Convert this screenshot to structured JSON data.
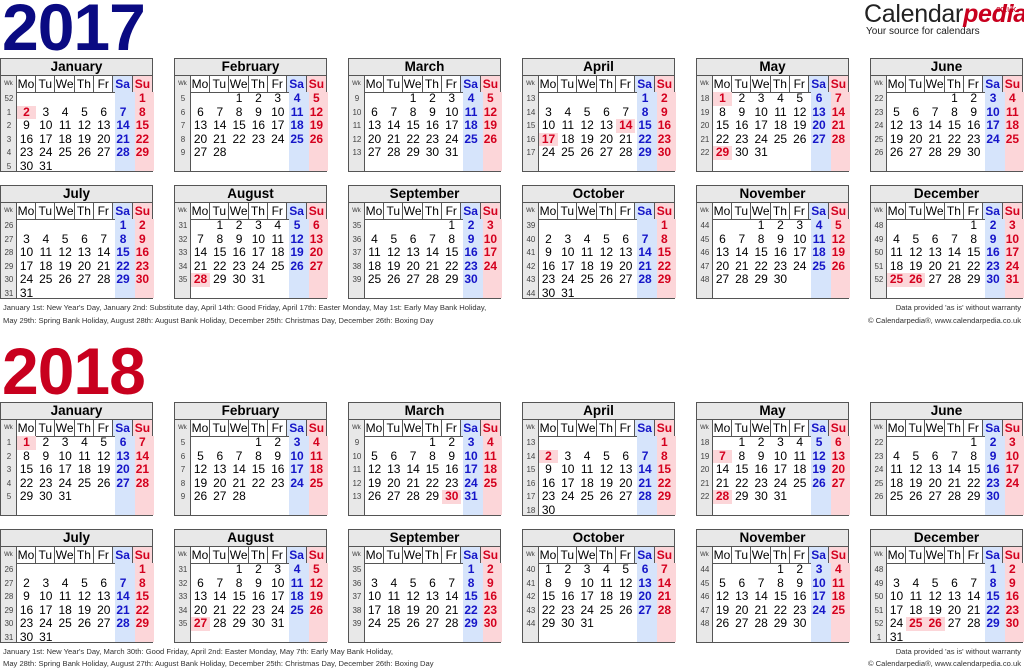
{
  "brand": {
    "name_main": "Calendar",
    "name_accent": "pedia",
    "tld": ".co.uk",
    "tagline": "Your source for calendars"
  },
  "colors": {
    "year2017": "#0a0a82",
    "year2018": "#c8001e",
    "saturday": "#1515c8",
    "sunday": "#d4001e",
    "saturday_bg": "#d6e4fb",
    "sunday_bg": "#fcd6d9",
    "header_bg": "#e8e8e8"
  },
  "day_headers": {
    "wk": "Wk",
    "days": [
      "Mo",
      "Tu",
      "We",
      "Th",
      "Fr",
      "Sa",
      "Su"
    ]
  },
  "years": [
    {
      "year": "2017",
      "holidays_note_line1": "January 1st: New Year's Day, January 2nd: Substitute day, April 14th: Good Friday, April 17th: Easter Monday, May 1st: Early May Bank Holiday,",
      "holidays_note_line2": "May 29th: Spring Bank Holiday, August 28th: August Bank Holiday, December 25th: Christmas Day, December 26th: Boxing Day",
      "disclaimer": "Data provided 'as is' without warranty",
      "copyright": "© Calendarpedia®, www.calendarpedia.co.uk",
      "months": [
        {
          "name": "January",
          "first_weekday": 6,
          "days": 31,
          "weeks": [
            52,
            1,
            2,
            3,
            4,
            5
          ],
          "holidays": [
            2
          ]
        },
        {
          "name": "February",
          "first_weekday": 2,
          "days": 28,
          "weeks": [
            5,
            6,
            7,
            8,
            9
          ],
          "holidays": []
        },
        {
          "name": "March",
          "first_weekday": 2,
          "days": 31,
          "weeks": [
            9,
            10,
            11,
            12,
            13
          ],
          "holidays": []
        },
        {
          "name": "April",
          "first_weekday": 5,
          "days": 30,
          "weeks": [
            13,
            14,
            15,
            16,
            17
          ],
          "holidays": [
            14,
            17
          ]
        },
        {
          "name": "May",
          "first_weekday": 0,
          "days": 31,
          "weeks": [
            18,
            19,
            20,
            21,
            22
          ],
          "holidays": [
            1,
            29
          ]
        },
        {
          "name": "June",
          "first_weekday": 3,
          "days": 30,
          "weeks": [
            22,
            23,
            24,
            25,
            26
          ],
          "holidays": []
        },
        {
          "name": "July",
          "first_weekday": 5,
          "days": 31,
          "weeks": [
            26,
            27,
            28,
            29,
            30,
            31
          ],
          "holidays": []
        },
        {
          "name": "August",
          "first_weekday": 1,
          "days": 31,
          "weeks": [
            31,
            32,
            33,
            34,
            35
          ],
          "holidays": [
            28
          ]
        },
        {
          "name": "September",
          "first_weekday": 4,
          "days": 30,
          "weeks": [
            35,
            36,
            37,
            38,
            39
          ],
          "holidays": []
        },
        {
          "name": "October",
          "first_weekday": 6,
          "days": 31,
          "weeks": [
            39,
            40,
            41,
            42,
            43,
            44
          ],
          "holidays": []
        },
        {
          "name": "November",
          "first_weekday": 2,
          "days": 30,
          "weeks": [
            44,
            45,
            46,
            47,
            48
          ],
          "holidays": []
        },
        {
          "name": "December",
          "first_weekday": 4,
          "days": 31,
          "weeks": [
            48,
            49,
            50,
            51,
            52
          ],
          "holidays": [
            25,
            26
          ]
        }
      ]
    },
    {
      "year": "2018",
      "holidays_note_line1": "January 1st: New Year's Day, March 30th: Good Friday, April 2nd: Easter Monday, May 7th: Early May Bank Holiday,",
      "holidays_note_line2": "May 28th: Spring Bank Holiday, August 27th: August Bank Holiday, December 25th: Christmas Day, December 26th: Boxing Day",
      "disclaimer": "Data provided 'as is' without warranty",
      "copyright": "© Calendarpedia®, www.calendarpedia.co.uk",
      "months": [
        {
          "name": "January",
          "first_weekday": 0,
          "days": 31,
          "weeks": [
            1,
            2,
            3,
            4,
            5
          ],
          "holidays": [
            1
          ]
        },
        {
          "name": "February",
          "first_weekday": 3,
          "days": 28,
          "weeks": [
            5,
            6,
            7,
            8,
            9
          ],
          "holidays": []
        },
        {
          "name": "March",
          "first_weekday": 3,
          "days": 31,
          "weeks": [
            9,
            10,
            11,
            12,
            13
          ],
          "holidays": [
            30
          ]
        },
        {
          "name": "April",
          "first_weekday": 6,
          "days": 30,
          "weeks": [
            13,
            14,
            15,
            16,
            17,
            18
          ],
          "holidays": [
            2
          ]
        },
        {
          "name": "May",
          "first_weekday": 1,
          "days": 31,
          "weeks": [
            18,
            19,
            20,
            21,
            22
          ],
          "holidays": [
            7,
            28
          ]
        },
        {
          "name": "June",
          "first_weekday": 4,
          "days": 30,
          "weeks": [
            22,
            23,
            24,
            25,
            26
          ],
          "holidays": []
        },
        {
          "name": "July",
          "first_weekday": 6,
          "days": 31,
          "weeks": [
            26,
            27,
            28,
            29,
            30,
            31
          ],
          "holidays": []
        },
        {
          "name": "August",
          "first_weekday": 2,
          "days": 31,
          "weeks": [
            31,
            32,
            33,
            34,
            35
          ],
          "holidays": [
            27
          ]
        },
        {
          "name": "September",
          "first_weekday": 5,
          "days": 30,
          "weeks": [
            35,
            36,
            37,
            38,
            39
          ],
          "holidays": []
        },
        {
          "name": "October",
          "first_weekday": 0,
          "days": 31,
          "weeks": [
            40,
            41,
            42,
            43,
            44
          ],
          "holidays": []
        },
        {
          "name": "November",
          "first_weekday": 3,
          "days": 30,
          "weeks": [
            44,
            45,
            46,
            47,
            48
          ],
          "holidays": []
        },
        {
          "name": "December",
          "first_weekday": 5,
          "days": 31,
          "weeks": [
            48,
            49,
            50,
            51,
            52,
            1
          ],
          "holidays": [
            25,
            26
          ]
        }
      ]
    }
  ]
}
